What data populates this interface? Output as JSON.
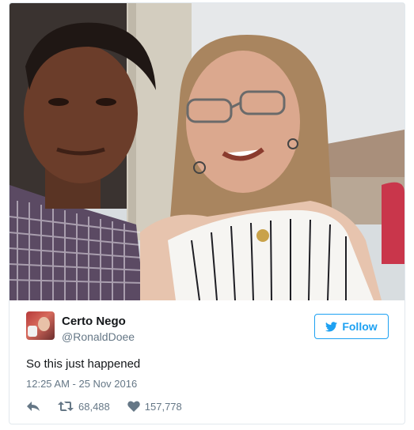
{
  "tweet": {
    "user": {
      "display_name": "Certo Nego",
      "screen_name": "@RonaldDoee",
      "avatar_icon": "user-avatar"
    },
    "follow_label": "Follow",
    "text": "So this just happened",
    "timestamp": "12:25 AM - 25 Nov 2016",
    "stats": {
      "retweets": "68,488",
      "likes": "157,778"
    },
    "icons": {
      "follow": "twitter-bird-icon",
      "reply": "reply-icon",
      "retweet": "retweet-icon",
      "like": "heart-icon"
    }
  },
  "colors": {
    "twitter_blue": "#1da1f2",
    "secondary_text": "#657786",
    "primary_text": "#14171a",
    "border": "#e1e8ed"
  }
}
